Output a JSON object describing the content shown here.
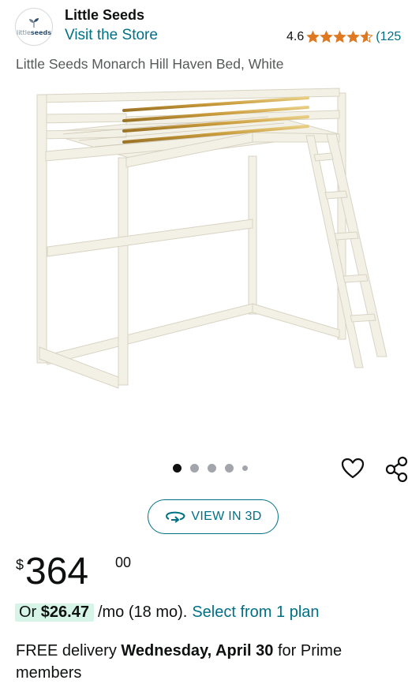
{
  "header": {
    "logo_text_a": "little",
    "logo_text_b": "seeds",
    "brand": "Little Seeds",
    "store_link": "Visit the Store",
    "rating_value": "4.6",
    "rating_stars": 4.6,
    "rating_count": "(125"
  },
  "product": {
    "title": "Little Seeds Monarch Hill Haven Bed, White"
  },
  "carousel": {
    "active_index": 0,
    "total": 5
  },
  "buttons": {
    "view_3d": "VIEW IN 3D"
  },
  "price": {
    "symbol": "$",
    "whole": "364",
    "fraction": "00"
  },
  "financing": {
    "prefix": "Or",
    "amount": "$26.47",
    "term": "/mo (18 mo).",
    "link": "Select from 1 plan"
  },
  "delivery": {
    "prefix": "FREE delivery",
    "date": "Wednesday, April 30",
    "suffix": "for Prime members"
  },
  "colors": {
    "link": "#007185",
    "star": "#de7921",
    "highlight": "#d6f5e8"
  }
}
